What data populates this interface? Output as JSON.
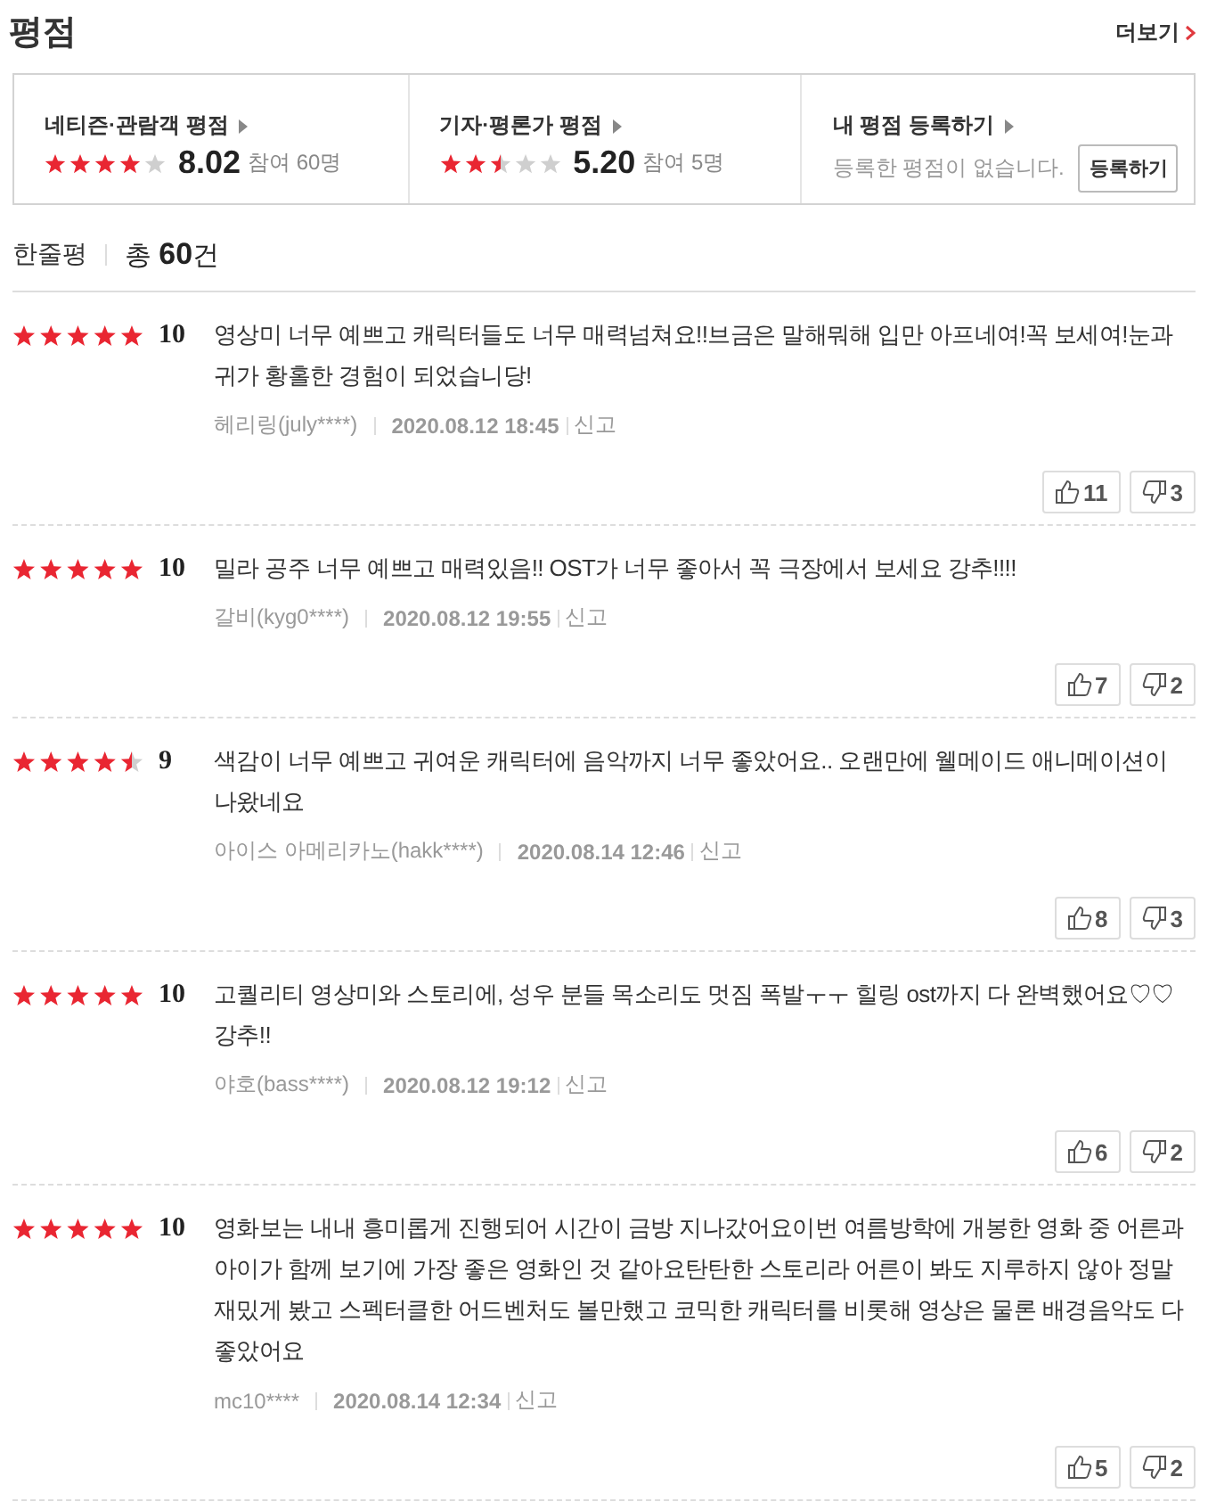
{
  "title": "평점",
  "more_link": "더보기",
  "summary": [
    {
      "kind": "score",
      "label": "네티즌·관람객 평점",
      "stars": 4,
      "score": "8.02",
      "count": "참여 60명"
    },
    {
      "kind": "score",
      "label": "기자·평론가 평점",
      "stars": 2.5,
      "score": "5.20",
      "count": "참여 5명"
    },
    {
      "kind": "register",
      "label": "내 평점 등록하기",
      "message": "등록한 평점이 없습니다.",
      "button": "등록하기"
    }
  ],
  "review_header": {
    "label": "한줄평",
    "total_prefix": "총",
    "total": "60",
    "total_suffix": "건"
  },
  "reviews": [
    {
      "stars": 5,
      "score": "10",
      "text": "영상미 너무 예쁘고 캐릭터들도 너무 매력넘쳐요!!브금은 말해뭐해 입만 아프네여!꼭 보세여!눈과 귀가 황홀한 경험이 되었습니당!",
      "author": "헤리링(july****)",
      "date": "2020.08.12 18:45",
      "report": "신고",
      "likes": "11",
      "dislikes": "3"
    },
    {
      "stars": 5,
      "score": "10",
      "text": "밀라 공주 너무 예쁘고 매력있음!! OST가 너무 좋아서 꼭 극장에서 보세요 강추!!!!",
      "author": "갈비(kyg0****)",
      "date": "2020.08.12 19:55",
      "report": "신고",
      "likes": "7",
      "dislikes": "2"
    },
    {
      "stars": 4.5,
      "score": "9",
      "text": "색감이 너무 예쁘고 귀여운 캐릭터에 음악까지 너무 좋았어요.. 오랜만에 웰메이드 애니메이션이 나왔네요",
      "author": "아이스 아메리카노(hakk****)",
      "date": "2020.08.14 12:46",
      "report": "신고",
      "likes": "8",
      "dislikes": "3"
    },
    {
      "stars": 5,
      "score": "10",
      "text": "고퀄리티 영상미와 스토리에, 성우 분들 목소리도 멋짐 폭발ㅜㅜ 힐링 ost까지 다 완벽했어요♡♡ 강추!!",
      "author": "야호(bass****)",
      "date": "2020.08.12 19:12",
      "report": "신고",
      "likes": "6",
      "dislikes": "2"
    },
    {
      "stars": 5,
      "score": "10",
      "text": "영화보는 내내 흥미롭게 진행되어 시간이 금방 지나갔어요이번 여름방학에 개봉한 영화 중 어른과 아이가 함께 보기에 가장 좋은 영화인 것 같아요탄탄한 스토리라 어른이 봐도 지루하지 않아 정말 재밌게 봤고 스펙터클한 어드벤처도 볼만했고 코믹한 캐릭터를 비롯해 영상은 물론 배경음악도 다 좋았어요",
      "author": "mc10****",
      "date": "2020.08.14 12:34",
      "report": "신고",
      "likes": "5",
      "dislikes": "2"
    }
  ]
}
